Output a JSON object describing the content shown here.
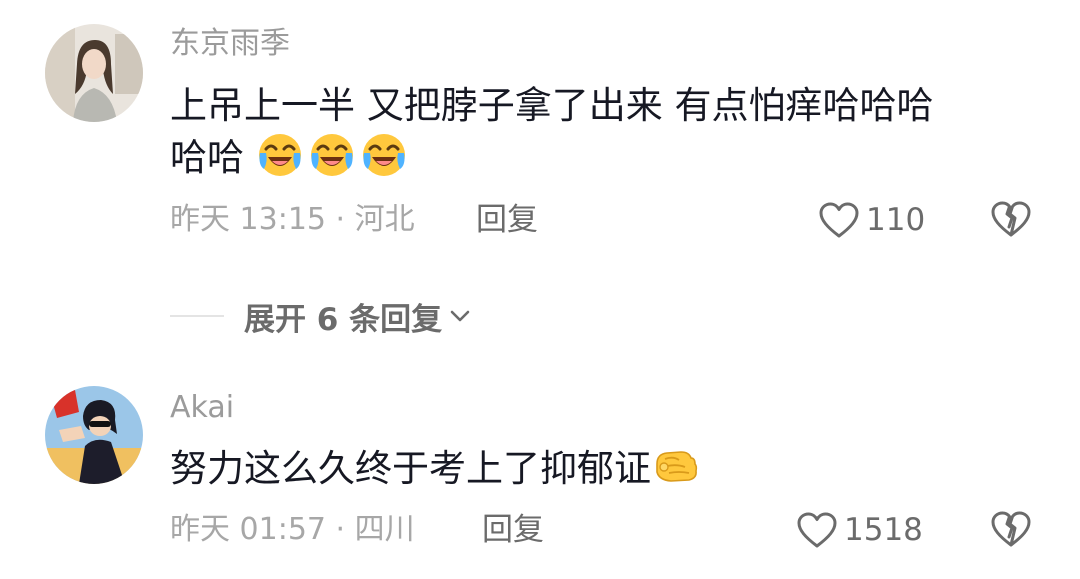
{
  "comments": [
    {
      "username": "东京雨季",
      "text_line1": "上吊上一半 又把脖子拿了出来 有点怕痒哈哈哈",
      "text_line2": "哈哈",
      "emojis": [
        "laughing-crying-emoji",
        "laughing-crying-emoji",
        "laughing-crying-emoji"
      ],
      "meta": "昨天 13:15 · 河北",
      "reply_label": "回复",
      "like_count": "110"
    },
    {
      "username": "Akai",
      "text": "努力这么久终于考上了抑郁证",
      "emojis": [
        "fist-emoji"
      ],
      "meta": "昨天 01:57 · 四川",
      "reply_label": "回复",
      "like_count": "1518"
    }
  ],
  "expand_replies": {
    "label": "展开 6 条回复"
  },
  "colors": {
    "text_primary": "#161823",
    "text_secondary": "#9b9b9b",
    "action_text": "#6b6b6b",
    "emoji_yellow": "#ffc83d"
  },
  "icons": {
    "like": "heart-outline-icon",
    "dislike": "broken-heart-icon",
    "expand": "chevron-down-icon"
  }
}
